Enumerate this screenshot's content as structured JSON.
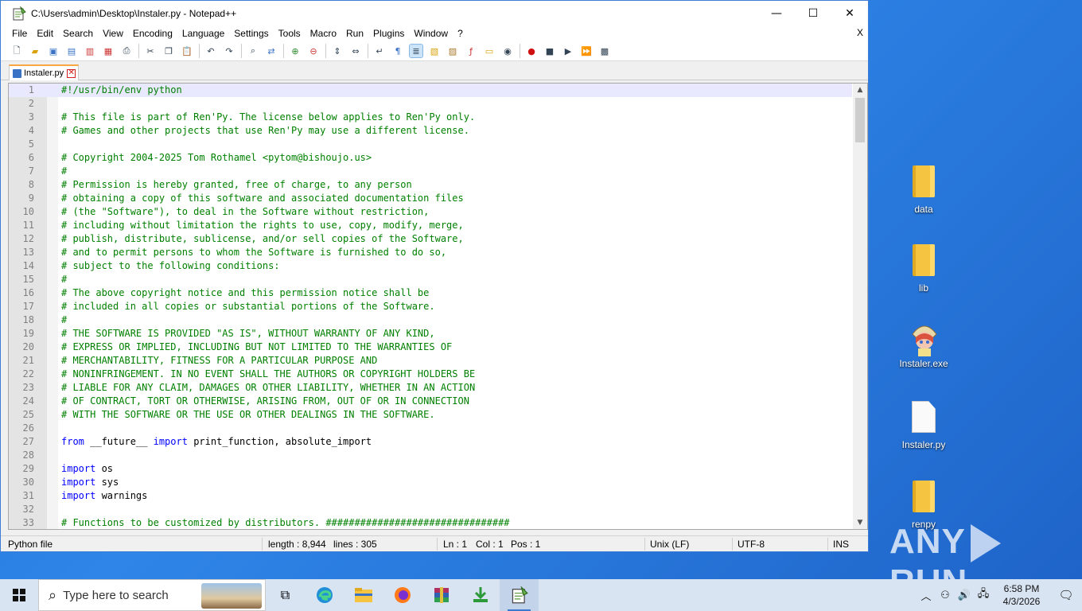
{
  "window": {
    "title": "C:\\Users\\admin\\Desktop\\Instaler.py - Notepad++",
    "minimize_glyph": "—",
    "maximize_glyph": "☐",
    "close_glyph": "✕"
  },
  "menu": {
    "items": [
      "File",
      "Edit",
      "Search",
      "View",
      "Encoding",
      "Language",
      "Settings",
      "Tools",
      "Macro",
      "Run",
      "Plugins",
      "Window",
      "?"
    ],
    "close_doc": "X"
  },
  "toolbar": {
    "icons": [
      "new-file-icon",
      "open-file-icon",
      "save-icon",
      "save-all-icon",
      "close-icon",
      "close-all-icon",
      "print-icon",
      "cut-icon",
      "copy-icon",
      "paste-icon",
      "undo-icon",
      "redo-icon",
      "find-icon",
      "replace-icon",
      "zoom-in-icon",
      "zoom-out-icon",
      "sync-vertical-icon",
      "sync-horizontal-icon",
      "word-wrap-icon",
      "show-all-chars-icon",
      "indent-guide-icon",
      "udl-icon",
      "doc-map-icon",
      "function-list-icon",
      "folder-as-workspace-icon",
      "monitoring-icon",
      "record-macro-icon",
      "stop-macro-icon",
      "play-macro-icon",
      "run-macro-multiple-icon",
      "save-macro-icon"
    ]
  },
  "tab": {
    "label": "Instaler.py"
  },
  "editor": {
    "lines": [
      {
        "n": "1",
        "text": "#!/usr/bin/env python",
        "type": "comment"
      },
      {
        "n": "2",
        "text": "",
        "type": "plain"
      },
      {
        "n": "3",
        "text": "# This file is part of Ren'Py. The license below applies to Ren'Py only.",
        "type": "comment"
      },
      {
        "n": "4",
        "text": "# Games and other projects that use Ren'Py may use a different license.",
        "type": "comment"
      },
      {
        "n": "5",
        "text": "",
        "type": "plain"
      },
      {
        "n": "6",
        "text": "# Copyright 2004-2025 Tom Rothamel <pytom@bishoujo.us>",
        "type": "comment"
      },
      {
        "n": "7",
        "text": "#",
        "type": "comment"
      },
      {
        "n": "8",
        "text": "# Permission is hereby granted, free of charge, to any person",
        "type": "comment"
      },
      {
        "n": "9",
        "text": "# obtaining a copy of this software and associated documentation files",
        "type": "comment"
      },
      {
        "n": "10",
        "text": "# (the \"Software\"), to deal in the Software without restriction,",
        "type": "comment"
      },
      {
        "n": "11",
        "text": "# including without limitation the rights to use, copy, modify, merge,",
        "type": "comment"
      },
      {
        "n": "12",
        "text": "# publish, distribute, sublicense, and/or sell copies of the Software,",
        "type": "comment"
      },
      {
        "n": "13",
        "text": "# and to permit persons to whom the Software is furnished to do so,",
        "type": "comment"
      },
      {
        "n": "14",
        "text": "# subject to the following conditions:",
        "type": "comment"
      },
      {
        "n": "15",
        "text": "#",
        "type": "comment"
      },
      {
        "n": "16",
        "text": "# The above copyright notice and this permission notice shall be",
        "type": "comment"
      },
      {
        "n": "17",
        "text": "# included in all copies or substantial portions of the Software.",
        "type": "comment"
      },
      {
        "n": "18",
        "text": "#",
        "type": "comment"
      },
      {
        "n": "19",
        "text": "# THE SOFTWARE IS PROVIDED \"AS IS\", WITHOUT WARRANTY OF ANY KIND,",
        "type": "comment"
      },
      {
        "n": "20",
        "text": "# EXPRESS OR IMPLIED, INCLUDING BUT NOT LIMITED TO THE WARRANTIES OF",
        "type": "comment"
      },
      {
        "n": "21",
        "text": "# MERCHANTABILITY, FITNESS FOR A PARTICULAR PURPOSE AND",
        "type": "comment"
      },
      {
        "n": "22",
        "text": "# NONINFRINGEMENT. IN NO EVENT SHALL THE AUTHORS OR COPYRIGHT HOLDERS BE",
        "type": "comment"
      },
      {
        "n": "23",
        "text": "# LIABLE FOR ANY CLAIM, DAMAGES OR OTHER LIABILITY, WHETHER IN AN ACTION",
        "type": "comment"
      },
      {
        "n": "24",
        "text": "# OF CONTRACT, TORT OR OTHERWISE, ARISING FROM, OUT OF OR IN CONNECTION",
        "type": "comment"
      },
      {
        "n": "25",
        "text": "# WITH THE SOFTWARE OR THE USE OR OTHER DEALINGS IN THE SOFTWARE.",
        "type": "comment"
      },
      {
        "n": "26",
        "text": "",
        "type": "plain"
      },
      {
        "n": "27",
        "kw": "from",
        "mid": " __future__ ",
        "kw2": "import",
        "rest": " print_function, absolute_import",
        "type": "import2"
      },
      {
        "n": "28",
        "text": "",
        "type": "plain"
      },
      {
        "n": "29",
        "kw": "import",
        "rest": " os",
        "type": "import"
      },
      {
        "n": "30",
        "kw": "import",
        "rest": " sys",
        "type": "import"
      },
      {
        "n": "31",
        "kw": "import",
        "rest": " warnings",
        "type": "import"
      },
      {
        "n": "32",
        "text": "",
        "type": "plain"
      },
      {
        "n": "33",
        "text": "# Functions to be customized by distributors. ################################",
        "type": "comment"
      }
    ]
  },
  "status": {
    "file_type": "Python file",
    "length": "length : 8,944",
    "lines": "lines : 305",
    "ln": "Ln : 1",
    "col": "Col : 1",
    "pos": "Pos : 1",
    "eol": "Unix (LF)",
    "encoding": "UTF-8",
    "mode": "INS"
  },
  "desktop": {
    "icons": [
      {
        "label": "data",
        "kind": "folder"
      },
      {
        "label": "lib",
        "kind": "folder"
      },
      {
        "label": "Instaler.exe",
        "kind": "exe"
      },
      {
        "label": "Instaler.py",
        "kind": "file"
      },
      {
        "label": "renpy",
        "kind": "folder"
      }
    ],
    "watermark_left": "ANY",
    "watermark_right": "RUN"
  },
  "taskbar": {
    "search_placeholder": "Type here to search",
    "apps": [
      "task-view-icon",
      "edge-icon",
      "file-explorer-icon",
      "firefox-icon",
      "winrar-icon",
      "downloader-icon",
      "notepadpp-icon"
    ],
    "time": "6:58 PM",
    "date": "4/3/2026"
  },
  "colors": {
    "comment": "#008000",
    "keyword": "#0000ff",
    "tab_accent": "#f9a742",
    "desktop_bg": "#2f86e8"
  }
}
